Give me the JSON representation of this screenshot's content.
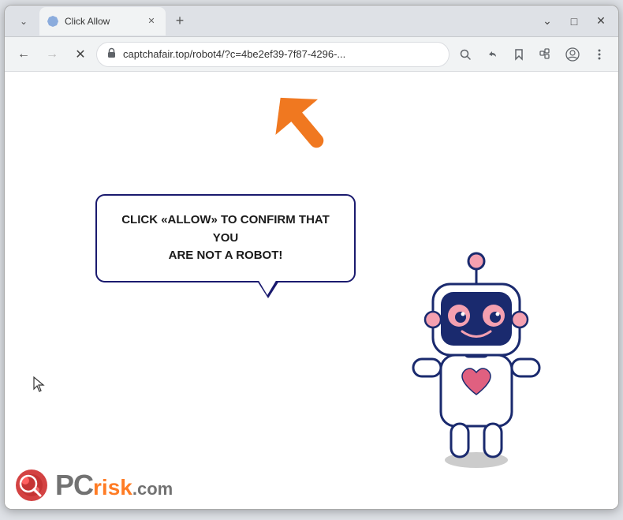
{
  "window": {
    "title": "Click Allow",
    "url": "captchafair.top/robot4/?c=4be2ef39-7f87-4296-...",
    "url_full": "captchafair.top/robot4/?c=4be2ef39-7f87-4296-...",
    "tab_label": "Click Allow",
    "new_tab_icon": "+",
    "controls": {
      "minimize": "—",
      "maximize": "□",
      "close": "✕",
      "chevron": "⌄"
    }
  },
  "nav": {
    "back_title": "Back",
    "forward_title": "Forward",
    "reload_title": "Reload",
    "lock_icon": "🔒",
    "search_title": "Search",
    "share_title": "Share",
    "bookmark_title": "Bookmark",
    "extensions_title": "Extensions",
    "profile_title": "Profile",
    "menu_title": "Menu"
  },
  "page": {
    "bubble_text_line1": "CLICK «ALLOW» TO CONFIRM THAT YOU",
    "bubble_text_line2": "ARE NOT A ROBOT!",
    "watermark_pc": "PC",
    "watermark_risk": "risk",
    "watermark_dotcom": ".com"
  },
  "colors": {
    "arrow_orange": "#f07820",
    "bubble_border": "#1a1a6e",
    "robot_body": "#ffffff",
    "robot_outline": "#1a2a6e",
    "robot_accent_pink": "#f4a0b0",
    "robot_heart": "#e06080",
    "nav_bg": "#f1f3f4",
    "title_bg": "#dee1e6"
  }
}
